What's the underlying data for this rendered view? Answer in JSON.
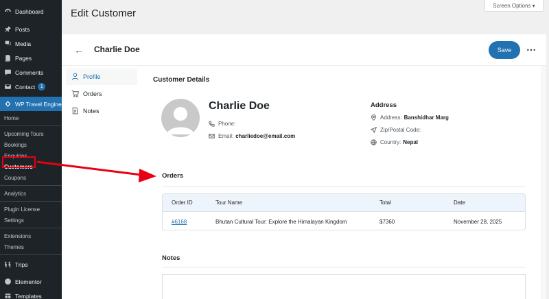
{
  "sidebar": {
    "dashboard": "Dashboard",
    "posts": "Posts",
    "media": "Media",
    "pages": "Pages",
    "comments": "Comments",
    "contact": "Contact",
    "contact_badge": "1",
    "wp_travel_engine": "WP Travel Engine",
    "home": "Home",
    "upcoming_tours": "Upcoming Tours",
    "bookings": "Bookings",
    "enquiries": "Enquiries",
    "customers": "Customers",
    "coupons": "Coupons",
    "analytics": "Analytics",
    "plugin_license": "Plugin License",
    "settings": "Settings",
    "extensions": "Extensions",
    "themes": "Themes",
    "trips": "Trips",
    "elementor": "Elementor",
    "templates": "Templates"
  },
  "header": {
    "page_title": "Edit Customer",
    "screen_options": "Screen Options ▾"
  },
  "topbar": {
    "customer_name": "Charlie Doe",
    "save_label": "Save",
    "more_label": "•••"
  },
  "tabs": [
    {
      "label": "Profile",
      "active": true
    },
    {
      "label": "Orders",
      "active": false
    },
    {
      "label": "Notes",
      "active": false
    }
  ],
  "customer": {
    "section_title": "Customer Details",
    "name": "Charlie Doe",
    "phone_label": "Phone:",
    "phone_value": "",
    "email_label": "Email:",
    "email_value": "charliedoe@email.com"
  },
  "address": {
    "title": "Address",
    "address_label": "Address:",
    "address_value": "Banshidhar Marg",
    "zip_label": "Zip/Postal Code:",
    "zip_value": "",
    "country_label": "Country:",
    "country_value": "Nepal"
  },
  "orders": {
    "title": "Orders",
    "columns": [
      "Order ID",
      "Tour Name",
      "Total",
      "Date"
    ],
    "rows": [
      {
        "id": "#6168",
        "tour": "Bhutan Cultural Tour: Explore the Himalayan Kingdom",
        "total": "$7360",
        "date": "November 28, 2025"
      }
    ]
  },
  "notes": {
    "title": "Notes"
  },
  "colors": {
    "accent": "#2271b1",
    "sidebar_bg": "#1d2327",
    "annotation_red": "#e60012"
  }
}
